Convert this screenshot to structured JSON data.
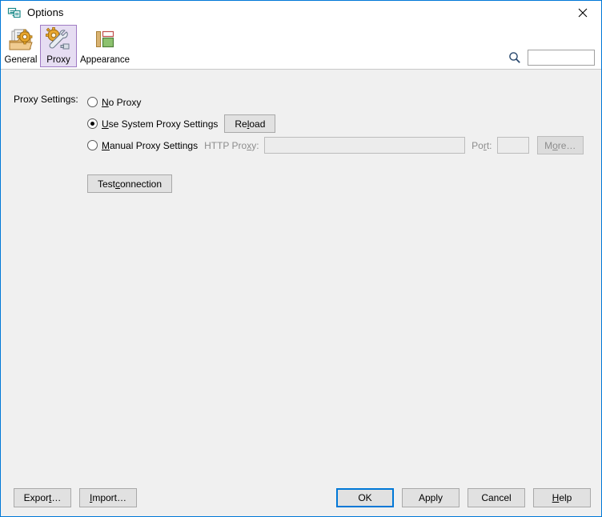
{
  "window": {
    "title": "Options",
    "icon": "options-window-icon",
    "close_label": "×",
    "border_color": "#0078d7",
    "background": "#f0f0f0"
  },
  "toolbar": {
    "items": [
      {
        "label": "General",
        "icon": "general-folder-gear-icon",
        "selected": false
      },
      {
        "label": "Proxy",
        "icon": "proxy-gear-wrench-icon",
        "selected": true
      },
      {
        "label": "Appearance",
        "icon": "appearance-layout-icon",
        "selected": false
      }
    ],
    "selected_highlight": "#e6ddf2",
    "selected_border": "#a07bc4"
  },
  "search": {
    "icon": "search-icon",
    "value": "",
    "placeholder": ""
  },
  "main": {
    "section_label": "Proxy Settings:",
    "options": [
      {
        "id": "no-proxy",
        "label_pre": "",
        "mnemonic": "N",
        "label_post": "o Proxy",
        "checked": false
      },
      {
        "id": "use-system-proxy",
        "label_pre": "",
        "mnemonic": "U",
        "label_post": "se System Proxy Settings",
        "checked": true
      },
      {
        "id": "manual-proxy",
        "label_pre": "",
        "mnemonic": "M",
        "label_post": "anual Proxy Settings",
        "checked": false
      }
    ],
    "reload_button": {
      "pre": "Re",
      "mnemonic": "l",
      "post": "oad",
      "disabled": false
    },
    "http_proxy_label": {
      "pre": "HTTP Pro",
      "mnemonic": "x",
      "post": "y:"
    },
    "http_proxy_value": "",
    "port_label": {
      "pre": "Po",
      "mnemonic": "r",
      "post": "t:"
    },
    "port_value": "",
    "more_button": {
      "pre": "M",
      "mnemonic": "o",
      "post": "re…",
      "disabled": true
    },
    "test_button": {
      "pre": "Test ",
      "mnemonic": "c",
      "post": "onnection",
      "disabled": false
    }
  },
  "footer": {
    "left_buttons": [
      {
        "pre": "Expor",
        "mnemonic": "t",
        "post": "…",
        "name": "export-button"
      },
      {
        "pre": "",
        "mnemonic": "I",
        "post": "mport…",
        "name": "import-button"
      }
    ],
    "right_buttons": [
      {
        "pre": "OK",
        "mnemonic": "",
        "post": "",
        "name": "ok-button",
        "focused": true
      },
      {
        "pre": "Apply",
        "mnemonic": "",
        "post": "",
        "name": "apply-button",
        "focused": false
      },
      {
        "pre": "Cancel",
        "mnemonic": "",
        "post": "",
        "name": "cancel-button",
        "focused": false
      },
      {
        "pre": "",
        "mnemonic": "H",
        "post": "elp",
        "name": "help-button",
        "focused": false
      }
    ]
  }
}
